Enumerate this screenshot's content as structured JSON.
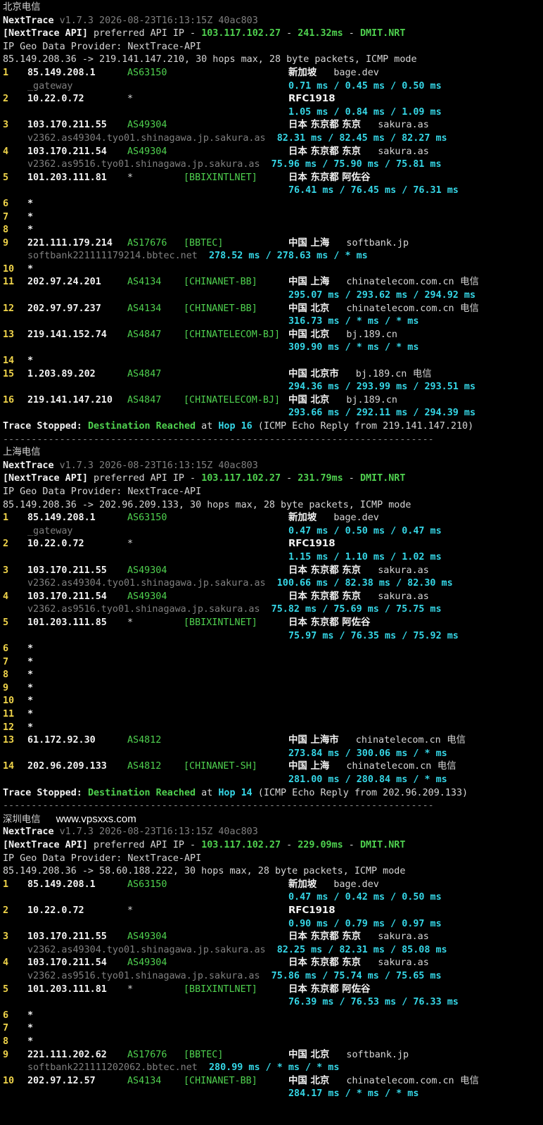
{
  "watermark": "www.vpsxxs.com",
  "sections": [
    {
      "title": "北京电信",
      "version_name": "NextTrace",
      "version_info": "v1.7.3 2026-08-23T16:13:15Z 40ac803",
      "api_tag": "[NextTrace API]",
      "api_text": " preferred API IP - ",
      "api_ip": "103.117.102.27",
      "api_latency": "241.32ms",
      "api_node": "DMIT.NRT",
      "geo_provider": "IP Geo Data Provider: NextTrace-API",
      "trace_header": "85.149.208.36 -> 219.141.147.210, 30 hops max, 28 byte packets, ICMP mode",
      "hops": [
        {
          "n": "1",
          "ip": "85.149.208.1",
          "asn": "AS63150",
          "tag": "",
          "geo": "新加坡",
          "host": "bage.dev",
          "isp": "",
          "ptr": "_gateway",
          "rtt": "0.71 ms / 0.45 ms / 0.50 ms",
          "ptr_inline": false
        },
        {
          "n": "2",
          "ip": "10.22.0.72",
          "asn": "*",
          "tag": "",
          "geo": "RFC1918",
          "host": "",
          "isp": "",
          "ptr": "",
          "rtt": "1.05 ms / 0.84 ms / 1.09 ms",
          "ptr_inline": false
        },
        {
          "n": "3",
          "ip": "103.170.211.55",
          "asn": "AS49304",
          "tag": "",
          "geo": "日本 东京都 东京",
          "host": "sakura.as",
          "isp": "",
          "ptr": "v2362.as49304.tyo01.shinagawa.jp.sakura.as",
          "rtt": "82.31 ms / 82.45 ms / 82.27 ms",
          "ptr_inline": true
        },
        {
          "n": "4",
          "ip": "103.170.211.54",
          "asn": "AS49304",
          "tag": "",
          "geo": "日本 东京都 东京",
          "host": "sakura.as",
          "isp": "",
          "ptr": "v2362.as9516.tyo01.shinagawa.jp.sakura.as",
          "rtt": "75.96 ms / 75.90 ms / 75.81 ms",
          "ptr_inline": true
        },
        {
          "n": "5",
          "ip": "101.203.111.81",
          "asn": "*",
          "tag": "[BBIXINTLNET]",
          "geo": "日本 东京都 阿佐谷",
          "host": "",
          "isp": "",
          "ptr": "",
          "rtt": "76.41 ms / 76.45 ms / 76.31 ms",
          "ptr_inline": false
        },
        {
          "n": "6",
          "star": true
        },
        {
          "n": "7",
          "star": true
        },
        {
          "n": "8",
          "star": true
        },
        {
          "n": "9",
          "ip": "221.111.179.214",
          "asn": "AS17676",
          "tag": "[BBTEC]",
          "geo": "中国 上海",
          "host": "softbank.jp",
          "isp": "",
          "ptr": "softbank221111179214.bbtec.net",
          "rtt": "278.52 ms / 278.63 ms / * ms",
          "ptr_inline": true
        },
        {
          "n": "10",
          "star": true,
          "no_gap": true
        },
        {
          "n": "11",
          "ip": "202.97.24.201",
          "asn": "AS4134",
          "tag": "[CHINANET-BB]",
          "geo": "中国 上海",
          "host": "chinatelecom.com.cn",
          "isp": "电信",
          "ptr": "",
          "rtt": "295.07 ms / 293.62 ms / 294.92 ms",
          "ptr_inline": false
        },
        {
          "n": "12",
          "ip": "202.97.97.237",
          "asn": "AS4134",
          "tag": "[CHINANET-BB]",
          "geo": "中国 北京",
          "host": "chinatelecom.com.cn",
          "isp": "电信",
          "ptr": "",
          "rtt": "316.73 ms / * ms / * ms",
          "ptr_inline": false
        },
        {
          "n": "13",
          "ip": "219.141.152.74",
          "asn": "AS4847",
          "tag": "[CHINATELECOM-BJ]",
          "geo": "中国 北京",
          "host": "bj.189.cn",
          "isp": "",
          "ptr": "",
          "rtt": "309.90 ms / * ms / * ms",
          "ptr_inline": false
        },
        {
          "n": "14",
          "star": true
        },
        {
          "n": "15",
          "ip": "1.203.89.202",
          "asn": "AS4847",
          "tag": "",
          "geo": "中国 北京市",
          "host": "bj.189.cn",
          "isp": "电信",
          "ptr": "",
          "rtt": "294.36 ms / 293.99 ms / 293.51 ms",
          "ptr_inline": false
        },
        {
          "n": "16",
          "ip": "219.141.147.210",
          "asn": "AS4847",
          "tag": "[CHINATELECOM-BJ]",
          "geo": "中国 北京",
          "host": "bj.189.cn",
          "isp": "",
          "ptr": "",
          "rtt": "293.66 ms / 292.11 ms / 294.39 ms",
          "ptr_inline": false
        }
      ],
      "stop_label": "Trace Stopped:",
      "stop_reached": "Destination Reached",
      "stop_at": "at",
      "stop_hop": "Hop 16",
      "stop_detail": "(ICMP Echo Reply from 219.141.147.210)",
      "separator": "----------------------------------------------------------------------------",
      "watermark": false
    },
    {
      "title": "上海电信",
      "version_name": "NextTrace",
      "version_info": "v1.7.3 2026-08-23T16:13:15Z 40ac803",
      "api_tag": "[NextTrace API]",
      "api_text": " preferred API IP - ",
      "api_ip": "103.117.102.27",
      "api_latency": "231.79ms",
      "api_node": "DMIT.NRT",
      "geo_provider": "IP Geo Data Provider: NextTrace-API",
      "trace_header": "85.149.208.36 -> 202.96.209.133, 30 hops max, 28 byte packets, ICMP mode",
      "hops": [
        {
          "n": "1",
          "ip": "85.149.208.1",
          "asn": "AS63150",
          "tag": "",
          "geo": "新加坡",
          "host": "bage.dev",
          "isp": "",
          "ptr": "_gateway",
          "rtt": "0.47 ms / 0.50 ms / 0.47 ms",
          "ptr_inline": false
        },
        {
          "n": "2",
          "ip": "10.22.0.72",
          "asn": "*",
          "tag": "",
          "geo": "RFC1918",
          "host": "",
          "isp": "",
          "ptr": "",
          "rtt": "1.15 ms / 1.10 ms / 1.02 ms",
          "ptr_inline": false
        },
        {
          "n": "3",
          "ip": "103.170.211.55",
          "asn": "AS49304",
          "tag": "",
          "geo": "日本 东京都 东京",
          "host": "sakura.as",
          "isp": "",
          "ptr": "v2362.as49304.tyo01.shinagawa.jp.sakura.as",
          "rtt": "100.66 ms / 82.38 ms / 82.30 ms",
          "ptr_inline": true
        },
        {
          "n": "4",
          "ip": "103.170.211.54",
          "asn": "AS49304",
          "tag": "",
          "geo": "日本 东京都 东京",
          "host": "sakura.as",
          "isp": "",
          "ptr": "v2362.as9516.tyo01.shinagawa.jp.sakura.as",
          "rtt": "75.82 ms / 75.69 ms / 75.75 ms",
          "ptr_inline": true
        },
        {
          "n": "5",
          "ip": "101.203.111.85",
          "asn": "*",
          "tag": "[BBIXINTLNET]",
          "geo": "日本 东京都 阿佐谷",
          "host": "",
          "isp": "",
          "ptr": "",
          "rtt": "75.97 ms / 76.35 ms / 75.92 ms",
          "ptr_inline": false
        },
        {
          "n": "6",
          "star": true
        },
        {
          "n": "7",
          "star": true,
          "no_gap": true
        },
        {
          "n": "8",
          "star": true,
          "no_gap": true
        },
        {
          "n": "9",
          "star": true,
          "no_gap": true
        },
        {
          "n": "10",
          "star": true,
          "no_gap": true
        },
        {
          "n": "11",
          "star": true,
          "no_gap": true
        },
        {
          "n": "12",
          "star": true,
          "no_gap": true
        },
        {
          "n": "13",
          "ip": "61.172.92.30",
          "asn": "AS4812",
          "tag": "",
          "geo": "中国 上海市",
          "host": "chinatelecom.cn",
          "isp": "电信",
          "ptr": "",
          "rtt": "273.84 ms / 300.06 ms / * ms",
          "ptr_inline": false
        },
        {
          "n": "14",
          "ip": "202.96.209.133",
          "asn": "AS4812",
          "tag": "[CHINANET-SH]",
          "geo": "中国 上海",
          "host": "chinatelecom.cn",
          "isp": "电信",
          "ptr": "",
          "rtt": "281.00 ms / 280.84 ms / * ms",
          "ptr_inline": false
        }
      ],
      "stop_label": "Trace Stopped:",
      "stop_reached": "Destination Reached",
      "stop_at": "at",
      "stop_hop": "Hop 14",
      "stop_detail": "(ICMP Echo Reply from 202.96.209.133)",
      "separator": "----------------------------------------------------------------------------",
      "watermark": false
    },
    {
      "title": "深圳电信",
      "version_name": "NextTrace",
      "version_info": "v1.7.3 2026-08-23T16:13:15Z 40ac803",
      "api_tag": "[NextTrace API]",
      "api_text": " preferred API IP - ",
      "api_ip": "103.117.102.27",
      "api_latency": "229.09ms",
      "api_node": "DMIT.NRT",
      "geo_provider": "IP Geo Data Provider: NextTrace-API",
      "trace_header": "85.149.208.36 -> 58.60.188.222, 30 hops max, 28 byte packets, ICMP mode",
      "hops": [
        {
          "n": "1",
          "ip": "85.149.208.1",
          "asn": "AS63150",
          "tag": "",
          "geo": "新加坡",
          "host": "bage.dev",
          "isp": "",
          "ptr": "",
          "rtt": "0.47 ms / 0.42 ms / 0.50 ms",
          "ptr_inline": false
        },
        {
          "n": "2",
          "ip": "10.22.0.72",
          "asn": "*",
          "tag": "",
          "geo": "RFC1918",
          "host": "",
          "isp": "",
          "ptr": "",
          "rtt": "0.90 ms / 0.79 ms / 0.97 ms",
          "ptr_inline": false
        },
        {
          "n": "3",
          "ip": "103.170.211.55",
          "asn": "AS49304",
          "tag": "",
          "geo": "日本 东京都 东京",
          "host": "sakura.as",
          "isp": "",
          "ptr": "v2362.as49304.tyo01.shinagawa.jp.sakura.as",
          "rtt": "82.25 ms / 82.31 ms / 85.08 ms",
          "ptr_inline": true
        },
        {
          "n": "4",
          "ip": "103.170.211.54",
          "asn": "AS49304",
          "tag": "",
          "geo": "日本 东京都 东京",
          "host": "sakura.as",
          "isp": "",
          "ptr": "v2362.as9516.tyo01.shinagawa.jp.sakura.as",
          "rtt": "75.86 ms / 75.74 ms / 75.65 ms",
          "ptr_inline": true
        },
        {
          "n": "5",
          "ip": "101.203.111.81",
          "asn": "*",
          "tag": "[BBIXINTLNET]",
          "geo": "日本 东京都 阿佐谷",
          "host": "",
          "isp": "",
          "ptr": "",
          "rtt": "76.39 ms / 76.53 ms / 76.33 ms",
          "ptr_inline": false
        },
        {
          "n": "6",
          "star": true
        },
        {
          "n": "7",
          "star": true,
          "no_gap": true
        },
        {
          "n": "8",
          "star": true,
          "no_gap": true
        },
        {
          "n": "9",
          "ip": "221.111.202.62",
          "asn": "AS17676",
          "tag": "[BBTEC]",
          "geo": "中国 北京",
          "host": "softbank.jp",
          "isp": "",
          "ptr": "softbank221111202062.bbtec.net",
          "rtt": "280.99 ms / * ms / * ms",
          "ptr_inline": true
        },
        {
          "n": "10",
          "ip": "202.97.12.57",
          "asn": "AS4134",
          "tag": "[CHINANET-BB]",
          "geo": "中国 北京",
          "host": "chinatelecom.com.cn",
          "isp": "电信",
          "ptr": "",
          "rtt": "284.17 ms / * ms / * ms",
          "ptr_inline": false
        }
      ],
      "watermark": true
    }
  ]
}
